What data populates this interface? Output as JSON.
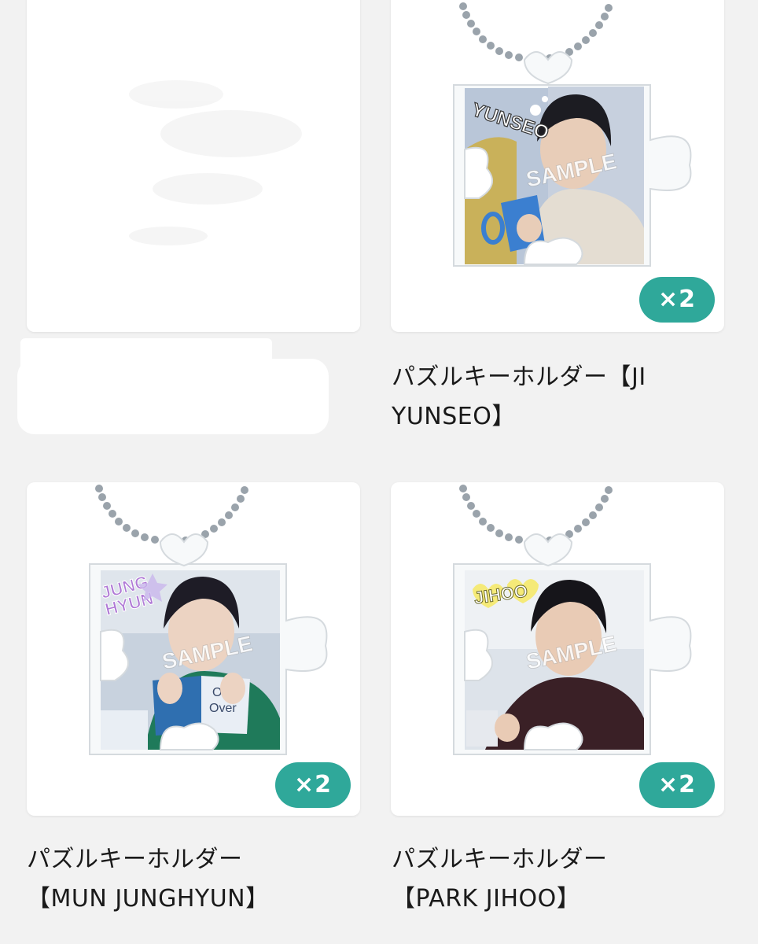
{
  "theme": {
    "badge_color": "#2fa89a",
    "background": "#f2f2f2",
    "card_background": "#ffffff"
  },
  "products": [
    {
      "name_line1": "",
      "name_line2": "",
      "quantity_badge": "",
      "image_redacted": true
    },
    {
      "name_line1": "パズルキーホルダー【JI",
      "name_line2": "YUNSEO】",
      "quantity_badge": "×2",
      "photo_tag": "YUNSEO",
      "watermark": "SAMPLE"
    },
    {
      "name_line1": "パズルキーホルダー",
      "name_line2": "【MUN JUNGHYUN】",
      "quantity_badge": "×2",
      "photo_tag_line1": "JUNG",
      "photo_tag_line2": "HYUN",
      "watermark": "SAMPLE",
      "book_text_line1": "One",
      "book_text_line2": "Over"
    },
    {
      "name_line1": "パズルキーホルダー",
      "name_line2": "【PARK JIHOO】",
      "quantity_badge": "×2",
      "photo_tag": "JIHOO",
      "watermark": "SAMPLE"
    }
  ]
}
